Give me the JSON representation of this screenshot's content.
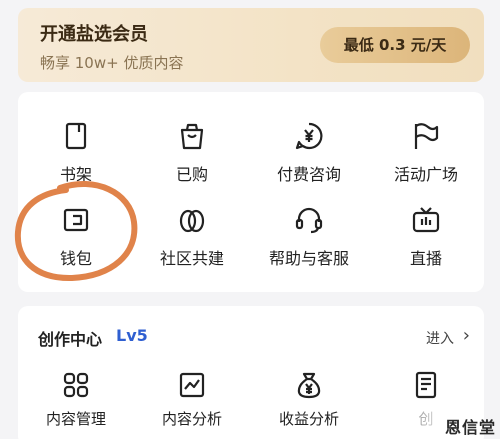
{
  "vip": {
    "title": "开通盐选会员",
    "subtitle": "畅享 10w+ 优质内容",
    "price_button": "最低 0.3 元/天"
  },
  "grid": [
    {
      "label": "书架",
      "icon": "bookshelf-icon"
    },
    {
      "label": "已购",
      "icon": "shopping-bag-icon"
    },
    {
      "label": "付费咨询",
      "icon": "paid-consult-icon"
    },
    {
      "label": "活动广场",
      "icon": "flag-icon"
    },
    {
      "label": "钱包",
      "icon": "wallet-icon"
    },
    {
      "label": "社区共建",
      "icon": "community-icon"
    },
    {
      "label": "帮助与客服",
      "icon": "headset-icon"
    },
    {
      "label": "直播",
      "icon": "live-tv-icon"
    }
  ],
  "creator": {
    "title": "创作中心",
    "level": "Lv5",
    "enter": "进入",
    "items": [
      {
        "label": "内容管理",
        "icon": "grid-apps-icon"
      },
      {
        "label": "内容分析",
        "icon": "chart-icon"
      },
      {
        "label": "收益分析",
        "icon": "money-bag-icon"
      },
      {
        "label": "创",
        "icon": "document-icon"
      }
    ]
  },
  "watermark": "恩信堂",
  "annotation_color": "#e0834a"
}
